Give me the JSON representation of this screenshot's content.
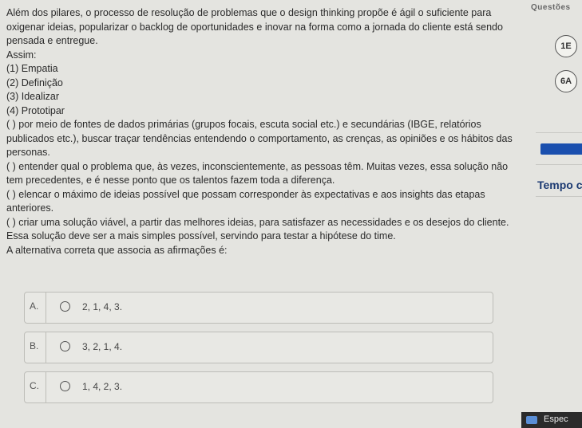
{
  "question": {
    "intro": "Além dos pilares, o processo de resolução de problemas que o design thinking propõe é ágil o suficiente para oxigenar ideias, popularizar o backlog de oportunidades e inovar na forma como a jornada do cliente está sendo pensada e entregue.",
    "assim": "Assim:",
    "steps": [
      "(1) Empatia",
      "(2) Definição",
      "(3) Idealizar",
      "(4) Prototipar"
    ],
    "statements": [
      "( ) por meio de fontes de dados primárias (grupos focais, escuta social etc.) e secundárias (IBGE, relatórios publicados etc.), buscar traçar tendências entendendo o comportamento, as crenças, as opiniões e os hábitos das personas.",
      "( ) entender qual o problema que, às vezes, inconscientemente, as pessoas têm. Muitas vezes, essa solução não tem precedentes, e é nesse ponto que os talentos fazem toda a diferença.",
      "( ) elencar o máximo de ideias possível que possam corresponder às expectativas e aos insights das etapas anteriores.",
      "( ) criar uma solução viável, a partir das melhores ideias, para satisfazer as necessidades e os desejos do cliente. Essa solução deve ser a mais simples possível, servindo para testar a hipótese do time."
    ],
    "prompt": "A alternativa correta que associa as afirmações é:"
  },
  "options": [
    {
      "letter": "A.",
      "text": "2, 1, 4, 3."
    },
    {
      "letter": "B.",
      "text": "3, 2, 1, 4."
    },
    {
      "letter": "C.",
      "text": "1, 4, 2, 3."
    }
  ],
  "sidebar": {
    "title": "Questões",
    "badges": [
      "1E",
      "6A"
    ],
    "tempo_label": "Tempo c"
  },
  "taskbar": {
    "label": "Espec"
  }
}
